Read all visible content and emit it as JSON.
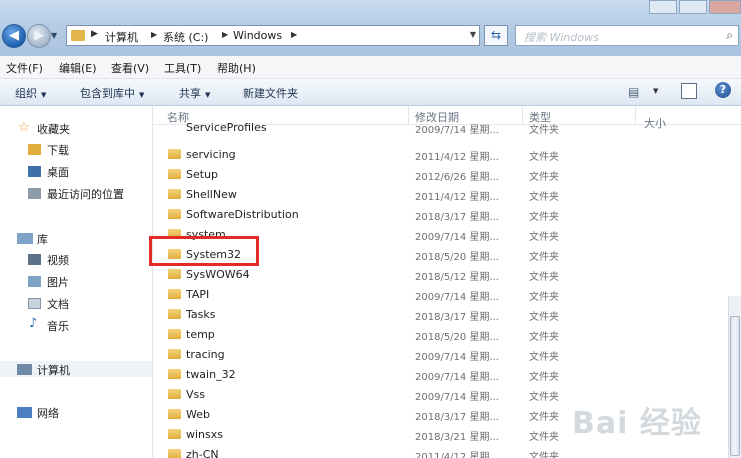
{
  "address": {
    "crumbs": [
      "计算机",
      "系统 (C:)",
      "Windows"
    ]
  },
  "search": {
    "placeholder": "搜索 Windows"
  },
  "menu": [
    "文件(F)",
    "编辑(E)",
    "查看(V)",
    "工具(T)",
    "帮助(H)"
  ],
  "commands": [
    "组织",
    "包含到库中",
    "共享",
    "新建文件夹"
  ],
  "nav": {
    "favorites": "收藏夹",
    "favorites_items": [
      "下载",
      "桌面",
      "最近访问的位置"
    ],
    "libraries": "库",
    "libraries_items": [
      "视频",
      "图片",
      "文档",
      "音乐"
    ],
    "computer": "计算机",
    "network": "网络"
  },
  "columns": {
    "name": "名称",
    "date": "修改日期",
    "type": "类型",
    "size": "大小"
  },
  "files": [
    {
      "name": "ServiceProfiles",
      "date": "2009/7/14 星期...",
      "type": "文件夹"
    },
    {
      "name": "servicing",
      "date": "2011/4/12 星期...",
      "type": "文件夹"
    },
    {
      "name": "Setup",
      "date": "2012/6/26 星期...",
      "type": "文件夹"
    },
    {
      "name": "ShellNew",
      "date": "2011/4/12 星期...",
      "type": "文件夹"
    },
    {
      "name": "SoftwareDistribution",
      "date": "2018/3/17 星期...",
      "type": "文件夹"
    },
    {
      "name": "system",
      "date": "2009/7/14 星期...",
      "type": "文件夹"
    },
    {
      "name": "System32",
      "date": "2018/5/20 星期...",
      "type": "文件夹"
    },
    {
      "name": "SysWOW64",
      "date": "2018/5/12 星期...",
      "type": "文件夹"
    },
    {
      "name": "TAPI",
      "date": "2009/7/14 星期...",
      "type": "文件夹"
    },
    {
      "name": "Tasks",
      "date": "2018/3/17 星期...",
      "type": "文件夹"
    },
    {
      "name": "temp",
      "date": "2018/5/20 星期...",
      "type": "文件夹"
    },
    {
      "name": "tracing",
      "date": "2009/7/14 星期...",
      "type": "文件夹"
    },
    {
      "name": "twain_32",
      "date": "2009/7/14 星期...",
      "type": "文件夹"
    },
    {
      "name": "Vss",
      "date": "2009/7/14 星期...",
      "type": "文件夹"
    },
    {
      "name": "Web",
      "date": "2018/3/17 星期...",
      "type": "文件夹"
    },
    {
      "name": "winsxs",
      "date": "2018/3/21 星期...",
      "type": "文件夹"
    },
    {
      "name": "zh-CN",
      "date": "2011/4/12 星期...",
      "type": "文件夹"
    }
  ],
  "watermark": "Bai 经验",
  "colors": {
    "highlight": "#e22a26",
    "folder": "#e0ad3d",
    "titlebar": "#b7cde6"
  }
}
